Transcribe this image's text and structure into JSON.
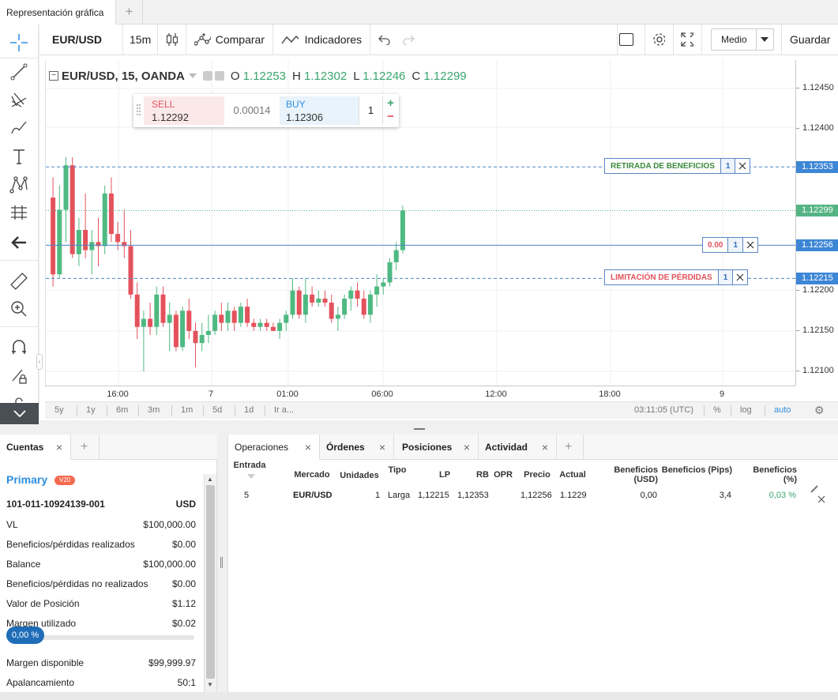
{
  "tab": {
    "title": "Representación gráfica"
  },
  "toolbar": {
    "symbol": "EUR/USD",
    "interval": "15m",
    "compare_label": "Comparar",
    "indicators_label": "Indicadores",
    "size_select": "Medio",
    "save_label": "Guardar"
  },
  "legend": {
    "symbol": "EUR/USD, 15, OANDA",
    "o_key": "O",
    "o": "1.12253",
    "h_key": "H",
    "h": "1.12302",
    "l_key": "L",
    "l": "1.12246",
    "c_key": "C",
    "c": "1.12299"
  },
  "trade_panel": {
    "sell_label": "SELL",
    "sell_price": "1.12292",
    "spread": "0.00014",
    "buy_label": "BUY",
    "buy_price": "1.12306",
    "quantity": "1"
  },
  "orders": {
    "take_profit_label": "RETIRADA DE BENEFICIOS",
    "take_profit_qty": "1",
    "take_profit_price": "1.12353",
    "position_pl": "0.00",
    "position_qty": "1",
    "position_price": "1.12256",
    "stop_loss_label": "LIMITACIÓN DE PÉRDIDAS",
    "stop_loss_qty": "1",
    "stop_loss_price": "1.12215",
    "last_price": "1.12299"
  },
  "price_axis": {
    "ticks": [
      "1.12450",
      "1.12400",
      "1.12200",
      "1.12150",
      "1.12100"
    ]
  },
  "time_axis": {
    "ticks": [
      "16:00",
      "7",
      "01:00",
      "06:00",
      "12:00",
      "18:00",
      "9"
    ]
  },
  "range_bar": {
    "ranges": [
      "5y",
      "1y",
      "6m",
      "3m",
      "1m",
      "5d",
      "1d",
      "Ir a..."
    ],
    "clock": "03:11:05 (UTC)",
    "percent": "%",
    "log": "log",
    "auto": "auto"
  },
  "colors": {
    "up": "#4fb982",
    "down": "#e4525c",
    "accent": "#2f8ee0",
    "line_blue": "#4d84c8"
  },
  "chart_data": {
    "type": "candlestick",
    "price_range": [
      1.12075,
      1.12475
    ],
    "candles": [
      {
        "o": 1.12315,
        "h": 1.1234,
        "l": 1.12205,
        "c": 1.1222
      },
      {
        "o": 1.1222,
        "h": 1.1233,
        "l": 1.12215,
        "c": 1.123
      },
      {
        "o": 1.123,
        "h": 1.12365,
        "l": 1.1226,
        "c": 1.12355
      },
      {
        "o": 1.12355,
        "h": 1.12365,
        "l": 1.1224,
        "c": 1.12245
      },
      {
        "o": 1.12245,
        "h": 1.1229,
        "l": 1.1223,
        "c": 1.12275
      },
      {
        "o": 1.12275,
        "h": 1.1232,
        "l": 1.1224,
        "c": 1.1225
      },
      {
        "o": 1.1225,
        "h": 1.12275,
        "l": 1.1222,
        "c": 1.1226
      },
      {
        "o": 1.1226,
        "h": 1.1229,
        "l": 1.1223,
        "c": 1.12255
      },
      {
        "o": 1.12255,
        "h": 1.1233,
        "l": 1.12245,
        "c": 1.1232
      },
      {
        "o": 1.1232,
        "h": 1.1234,
        "l": 1.1226,
        "c": 1.1227
      },
      {
        "o": 1.1227,
        "h": 1.12285,
        "l": 1.1225,
        "c": 1.1226
      },
      {
        "o": 1.1226,
        "h": 1.123,
        "l": 1.1224,
        "c": 1.12255
      },
      {
        "o": 1.12255,
        "h": 1.12275,
        "l": 1.1219,
        "c": 1.12195
      },
      {
        "o": 1.12195,
        "h": 1.1221,
        "l": 1.1214,
        "c": 1.12155
      },
      {
        "o": 1.12155,
        "h": 1.12175,
        "l": 1.121,
        "c": 1.12165
      },
      {
        "o": 1.12165,
        "h": 1.12185,
        "l": 1.12145,
        "c": 1.12155
      },
      {
        "o": 1.12155,
        "h": 1.12205,
        "l": 1.12145,
        "c": 1.12195
      },
      {
        "o": 1.12195,
        "h": 1.12205,
        "l": 1.12155,
        "c": 1.1216
      },
      {
        "o": 1.1216,
        "h": 1.12185,
        "l": 1.12125,
        "c": 1.1217
      },
      {
        "o": 1.1217,
        "h": 1.12175,
        "l": 1.12125,
        "c": 1.1213
      },
      {
        "o": 1.1213,
        "h": 1.1218,
        "l": 1.12125,
        "c": 1.12175
      },
      {
        "o": 1.12175,
        "h": 1.1219,
        "l": 1.1214,
        "c": 1.1215
      },
      {
        "o": 1.1215,
        "h": 1.1216,
        "l": 1.12105,
        "c": 1.12135
      },
      {
        "o": 1.12135,
        "h": 1.1216,
        "l": 1.12125,
        "c": 1.12145
      },
      {
        "o": 1.12145,
        "h": 1.1217,
        "l": 1.12135,
        "c": 1.1215
      },
      {
        "o": 1.1215,
        "h": 1.12175,
        "l": 1.12145,
        "c": 1.1217
      },
      {
        "o": 1.1217,
        "h": 1.12185,
        "l": 1.1215,
        "c": 1.1216
      },
      {
        "o": 1.1216,
        "h": 1.12185,
        "l": 1.1215,
        "c": 1.12175
      },
      {
        "o": 1.12175,
        "h": 1.1218,
        "l": 1.1215,
        "c": 1.1216
      },
      {
        "o": 1.1216,
        "h": 1.12185,
        "l": 1.12155,
        "c": 1.1218
      },
      {
        "o": 1.1218,
        "h": 1.1219,
        "l": 1.12155,
        "c": 1.1216
      },
      {
        "o": 1.1216,
        "h": 1.12165,
        "l": 1.1215,
        "c": 1.12155
      },
      {
        "o": 1.12155,
        "h": 1.12165,
        "l": 1.1215,
        "c": 1.1216
      },
      {
        "o": 1.1216,
        "h": 1.12165,
        "l": 1.1215,
        "c": 1.12155
      },
      {
        "o": 1.12155,
        "h": 1.1216,
        "l": 1.1215,
        "c": 1.1215
      },
      {
        "o": 1.1215,
        "h": 1.12165,
        "l": 1.1214,
        "c": 1.1216
      },
      {
        "o": 1.1216,
        "h": 1.12175,
        "l": 1.1215,
        "c": 1.1217
      },
      {
        "o": 1.1217,
        "h": 1.12215,
        "l": 1.12165,
        "c": 1.122
      },
      {
        "o": 1.122,
        "h": 1.12205,
        "l": 1.12165,
        "c": 1.1217
      },
      {
        "o": 1.1217,
        "h": 1.12215,
        "l": 1.1216,
        "c": 1.12195
      },
      {
        "o": 1.12195,
        "h": 1.12205,
        "l": 1.1218,
        "c": 1.12185
      },
      {
        "o": 1.12185,
        "h": 1.122,
        "l": 1.1218,
        "c": 1.1219
      },
      {
        "o": 1.1219,
        "h": 1.122,
        "l": 1.1218,
        "c": 1.12185
      },
      {
        "o": 1.12185,
        "h": 1.12195,
        "l": 1.1216,
        "c": 1.12165
      },
      {
        "o": 1.12165,
        "h": 1.1218,
        "l": 1.1215,
        "c": 1.1217
      },
      {
        "o": 1.1217,
        "h": 1.12195,
        "l": 1.12165,
        "c": 1.1219
      },
      {
        "o": 1.1219,
        "h": 1.12205,
        "l": 1.12175,
        "c": 1.122
      },
      {
        "o": 1.122,
        "h": 1.1221,
        "l": 1.1218,
        "c": 1.1219
      },
      {
        "o": 1.1219,
        "h": 1.122,
        "l": 1.12165,
        "c": 1.1217
      },
      {
        "o": 1.1217,
        "h": 1.122,
        "l": 1.1216,
        "c": 1.12195
      },
      {
        "o": 1.12195,
        "h": 1.1222,
        "l": 1.1218,
        "c": 1.12205
      },
      {
        "o": 1.12205,
        "h": 1.12215,
        "l": 1.12195,
        "c": 1.1221
      },
      {
        "o": 1.1221,
        "h": 1.1224,
        "l": 1.12205,
        "c": 1.12235
      },
      {
        "o": 1.12235,
        "h": 1.1226,
        "l": 1.12225,
        "c": 1.1225
      },
      {
        "o": 1.1225,
        "h": 1.12305,
        "l": 1.12246,
        "c": 1.12299
      }
    ]
  },
  "accounts": {
    "tab_label": "Cuentas",
    "name": "Primary",
    "badge": "V20",
    "account_id": "101-011-10924139-001",
    "currency": "USD",
    "rows": [
      {
        "label": "VL",
        "value": "$100,000.00"
      },
      {
        "label": "Beneficios/pérdidas realizados",
        "value": "$0.00"
      },
      {
        "label": "Balance",
        "value": "$100,000.00"
      },
      {
        "label": "Beneficios/pérdidas no realizados",
        "value": "$0.00"
      },
      {
        "label": "Valor de Posición",
        "value": "$1.12"
      },
      {
        "label": "Margen utilizado",
        "value": "$0.02"
      }
    ],
    "margin_pct": "0,00 %",
    "margin_fill": 0,
    "rows2": [
      {
        "label": "Margen disponible",
        "value": "$99,999.97"
      },
      {
        "label": "Apalancamiento",
        "value": "50:1"
      }
    ]
  },
  "operations": {
    "tabs": [
      "Operaciones",
      "Órdenes",
      "Posiciones",
      "Actividad"
    ],
    "headers": [
      "Entrada",
      "Mercado",
      "Unidades",
      "Tipo",
      "LP",
      "RB",
      "OPR",
      "Precio",
      "Actual",
      "Beneficios (USD)",
      "Beneficios (Pips)",
      "Beneficios (%)"
    ],
    "row": {
      "entry": "5",
      "market": "EUR/USD",
      "units": "1",
      "type": "Larga",
      "lp": "1,12215",
      "rb": "1,12353",
      "opr": "",
      "price": "1,12256",
      "current": "1.1229",
      "pl_usd": "0,00",
      "pl_pips": "3,4",
      "pl_pct": "0,03 %"
    }
  }
}
